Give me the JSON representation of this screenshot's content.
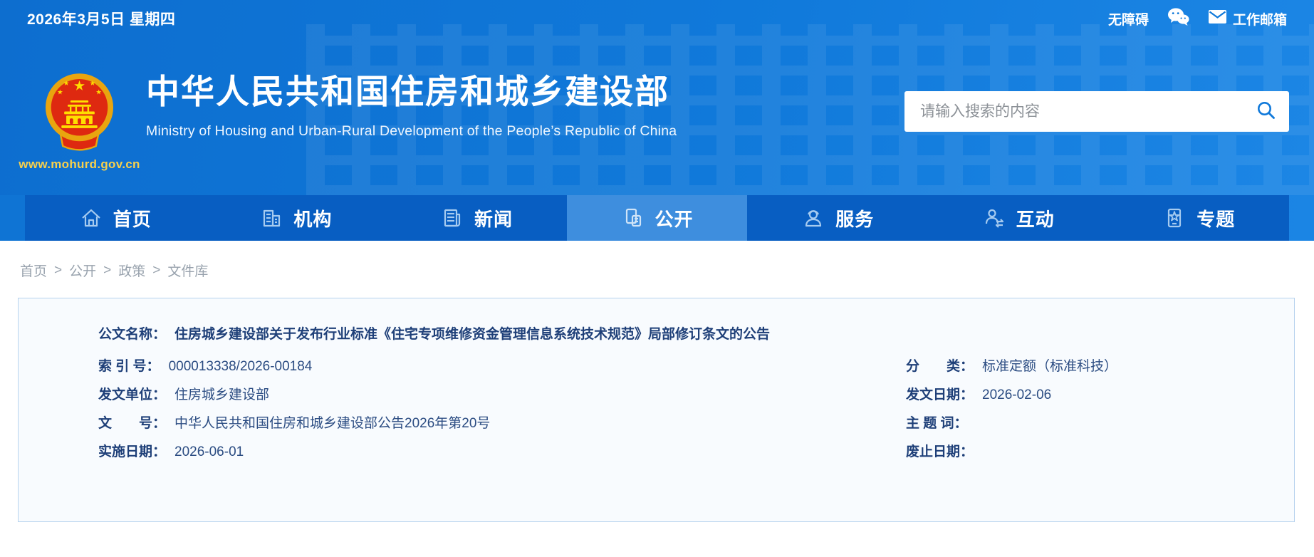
{
  "topbar": {
    "date": "2026年3月5日 星期四",
    "accessibility_label": "无障碍",
    "mailbox_label": "工作邮箱"
  },
  "header": {
    "site_title": "中华人民共和国住房和城乡建设部",
    "site_subtitle": "Ministry of Housing and Urban-Rural Development of the People’s Republic of China",
    "site_url": "www.mohurd.gov.cn",
    "search_placeholder": "请输入搜索的内容"
  },
  "nav": {
    "items": [
      {
        "label": "首页",
        "icon": "home-icon",
        "active": false
      },
      {
        "label": "机构",
        "icon": "organization-icon",
        "active": false
      },
      {
        "label": "新闻",
        "icon": "news-icon",
        "active": false
      },
      {
        "label": "公开",
        "icon": "disclosure-icon",
        "active": true
      },
      {
        "label": "服务",
        "icon": "service-icon",
        "active": false
      },
      {
        "label": "互动",
        "icon": "interaction-icon",
        "active": false
      },
      {
        "label": "专题",
        "icon": "topics-icon",
        "active": false
      }
    ]
  },
  "breadcrumb": {
    "separator": ">",
    "items": [
      "首页",
      "公开",
      "政策",
      "文件库"
    ]
  },
  "document": {
    "title_label": "公文名称：",
    "title": "住房城乡建设部关于发布行业标准《住宅专项维修资金管理信息系统技术规范》局部修订条文的公告",
    "fields_left": [
      {
        "label": "索 引 号：",
        "value": "000013338/2026-00184"
      },
      {
        "label": "发文单位：",
        "value": "住房城乡建设部"
      },
      {
        "label": "文　　号：",
        "value": "中华人民共和国住房和城乡建设部公告2026年第20号"
      },
      {
        "label": "实施日期：",
        "value": "2026-06-01"
      }
    ],
    "fields_right": [
      {
        "label": "分　　类：",
        "value": "标准定额（标准科技）"
      },
      {
        "label": "发文日期：",
        "value": "2026-02-06"
      },
      {
        "label": "主 题 词：",
        "value": ""
      },
      {
        "label": "废止日期：",
        "value": ""
      }
    ]
  },
  "colors": {
    "header_blue": "#1079da",
    "nav_blue": "#085ec2",
    "nav_active_blue": "#3e8ede",
    "emblem_gold": "#f0b400",
    "emblem_red": "#de2910",
    "url_gold": "#f7d04c",
    "label_navy": "#1e3f78",
    "value_navy": "#2b4c82",
    "card_bg": "#f8fbfe",
    "card_border": "#b6d2ee",
    "breadcrumb_gray": "#98a2ad"
  }
}
